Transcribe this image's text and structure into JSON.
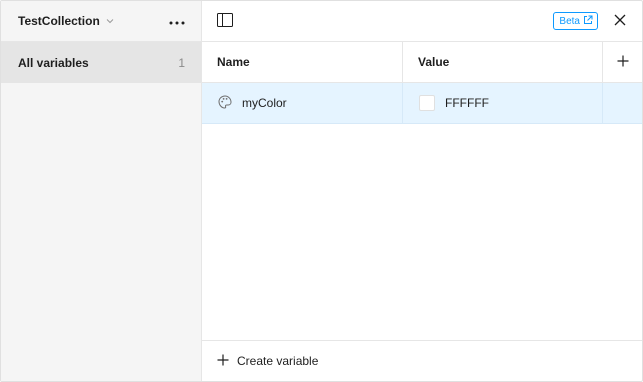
{
  "sidebar": {
    "collection_name": "TestCollection",
    "items": [
      {
        "label": "All variables",
        "count": "1"
      }
    ]
  },
  "toolbar": {
    "beta_label": "Beta"
  },
  "table": {
    "headers": {
      "name": "Name",
      "value": "Value"
    },
    "rows": [
      {
        "name": "myColor",
        "value": "FFFFFF",
        "swatch_color": "#FFFFFF"
      }
    ]
  },
  "footer": {
    "create_label": "Create variable"
  },
  "colors": {
    "accent": "#0d99ff",
    "selected_row": "#e5f4ff",
    "sidebar_bg": "#f5f5f5",
    "sidebar_selected": "#e5e5e5"
  }
}
